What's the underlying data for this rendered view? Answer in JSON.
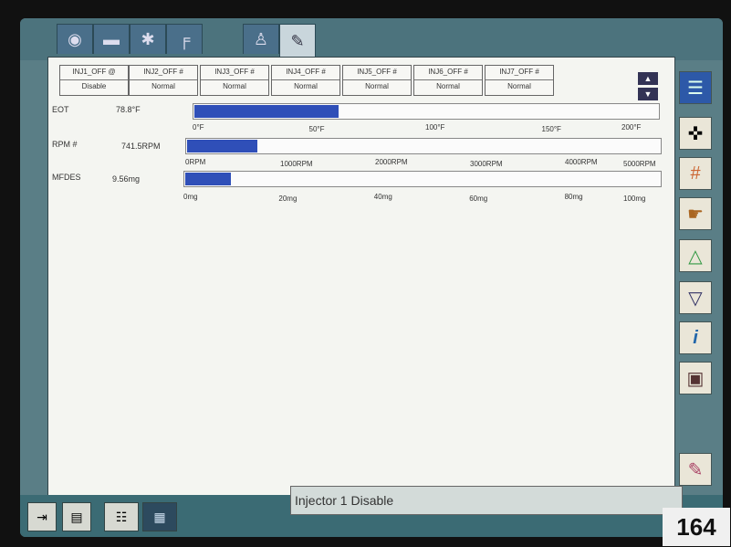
{
  "injectors": [
    {
      "name": "INJ1_OFF @",
      "state": "Disable"
    },
    {
      "name": "INJ2_OFF #",
      "state": "Normal"
    },
    {
      "name": "INJ3_OFF #",
      "state": "Normal"
    },
    {
      "name": "INJ4_OFF #",
      "state": "Normal"
    },
    {
      "name": "INJ5_OFF #",
      "state": "Normal"
    },
    {
      "name": "INJ6_OFF #",
      "state": "Normal"
    },
    {
      "name": "INJ7_OFF #",
      "state": "Normal"
    }
  ],
  "params": [
    {
      "name": "EOT",
      "value": "78.8°F",
      "fraction": 0.31,
      "ticks": [
        "0°F",
        "50°F",
        "100°F",
        "150°F",
        "200°F"
      ]
    },
    {
      "name": "RPM #",
      "value": "741.5RPM",
      "fraction": 0.148,
      "ticks": [
        "0RPM",
        "1000RPM",
        "2000RPM",
        "3000RPM",
        "4000RPM",
        "5000RPM"
      ]
    },
    {
      "name": "MFDES",
      "value": "9.56mg",
      "fraction": 0.096,
      "ticks": [
        "0mg",
        "20mg",
        "40mg",
        "60mg",
        "80mg",
        "100mg"
      ]
    }
  ],
  "status_text": "Injector 1 Disable",
  "page_number": "164",
  "colors": {
    "bar_fill": "#2f4fb8",
    "panel": "#f4f5f1",
    "frame": "#5a7e86"
  },
  "icons": {
    "top_tabs": [
      "logo-icon",
      "vehicle-icon",
      "engine-icon",
      "tool-icon",
      "seat-icon",
      "diagnostic-icon"
    ],
    "sidebar": [
      "list-icon",
      "camera-icon",
      "grid-icon",
      "hand-icon",
      "graph-icon",
      "dropdown-icon",
      "info-icon",
      "print-icon",
      "eraser-icon"
    ],
    "bottom": [
      "exit-icon",
      "book-icon",
      "data-list-icon",
      "data-grid-icon"
    ]
  }
}
